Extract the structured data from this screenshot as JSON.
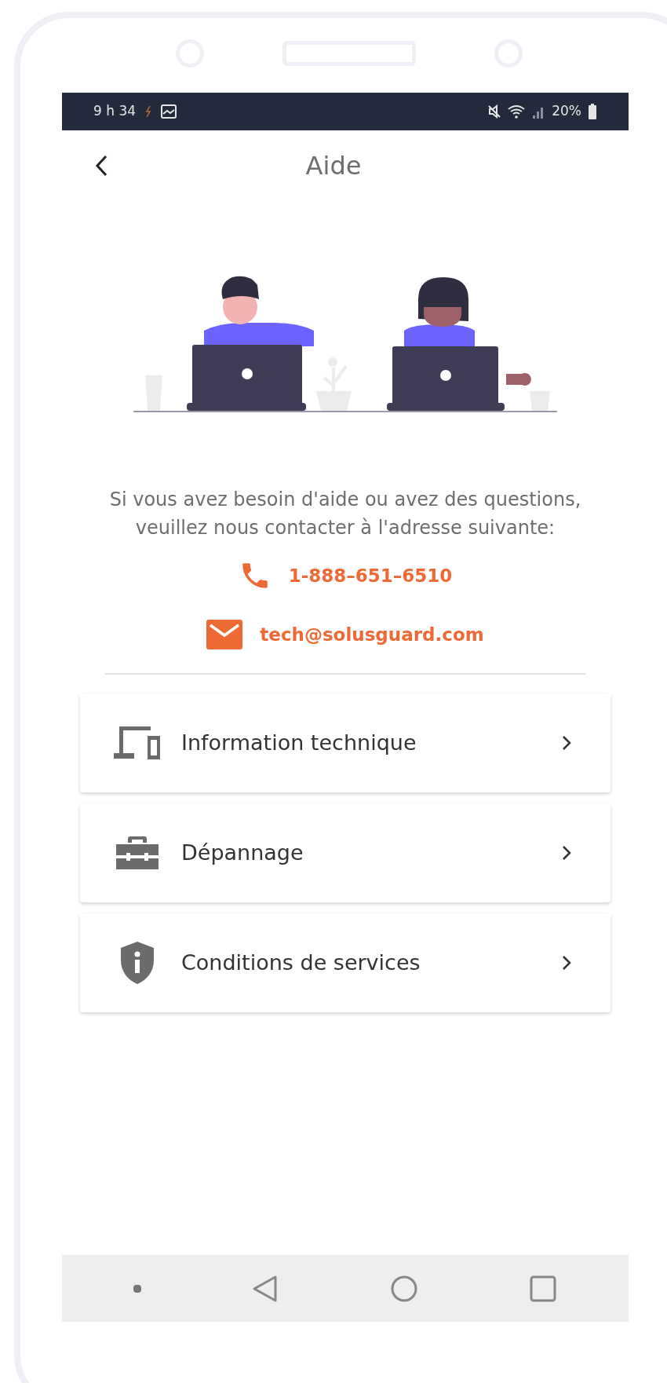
{
  "status_bar": {
    "time": "9 h 34",
    "battery": "20%"
  },
  "header": {
    "title": "Aide"
  },
  "message": "Si vous avez besoin d'aide ou avez des questions, veuillez nous contacter à l'adresse suivante:",
  "contacts": [
    {
      "kind": "phone",
      "text": "1-888–651–6510"
    },
    {
      "kind": "email",
      "text": "tech@solusguard.com"
    }
  ],
  "menu": [
    {
      "kind": "devices",
      "label": "Information technique"
    },
    {
      "kind": "toolbox",
      "label": "Dépannage"
    },
    {
      "kind": "shield",
      "label": "Conditions de services"
    }
  ]
}
